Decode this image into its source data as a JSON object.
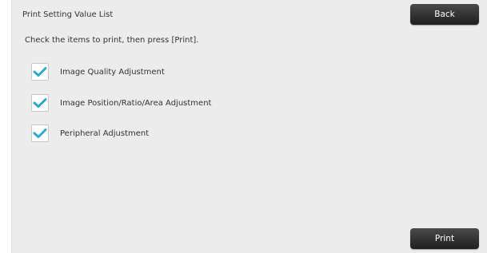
{
  "header": {
    "title": "Print Setting Value List",
    "back_label": "Back"
  },
  "main": {
    "instructions": "Check the items to print, then press [Print].",
    "options": [
      {
        "label": "Image Quality Adjustment",
        "checked": true
      },
      {
        "label": "Image Position/Ratio/Area Adjustment",
        "checked": true
      },
      {
        "label": "Peripheral Adjustment",
        "checked": true
      }
    ]
  },
  "footer": {
    "print_label": "Print"
  },
  "colors": {
    "check_accent": "#29a9d4",
    "button_dark": "#2b2b2b",
    "panel_bg": "#ececec"
  }
}
